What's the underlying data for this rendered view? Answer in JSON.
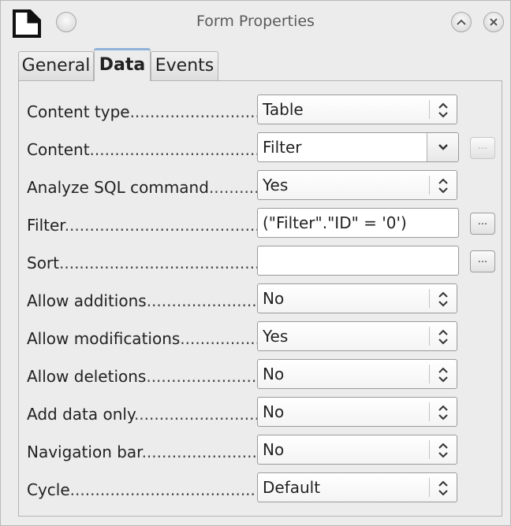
{
  "window": {
    "title": "Form Properties"
  },
  "tabs": [
    {
      "label": "General"
    },
    {
      "label": "Data"
    },
    {
      "label": "Events"
    }
  ],
  "rows": [
    {
      "label": "Content type",
      "value": "Table",
      "control": "listbox"
    },
    {
      "label": "Content",
      "value": "Filter",
      "control": "combobox",
      "button": "...",
      "button_enabled": false
    },
    {
      "label": "Analyze SQL command",
      "value": "Yes",
      "control": "listbox"
    },
    {
      "label": "Filter",
      "value": "(\"Filter\".\"ID\" = '0')",
      "control": "textfield",
      "button": "...",
      "button_enabled": true
    },
    {
      "label": "Sort",
      "value": "",
      "control": "textfield",
      "button": "...",
      "button_enabled": true
    },
    {
      "label": "Allow additions",
      "value": "No",
      "control": "listbox"
    },
    {
      "label": "Allow modifications",
      "value": "Yes",
      "control": "listbox"
    },
    {
      "label": "Allow deletions",
      "value": "No",
      "control": "listbox"
    },
    {
      "label": "Add data only",
      "value": "No",
      "control": "listbox"
    },
    {
      "label": "Navigation bar",
      "value": "No",
      "control": "listbox"
    },
    {
      "label": "Cycle",
      "value": "Default",
      "control": "listbox"
    }
  ]
}
